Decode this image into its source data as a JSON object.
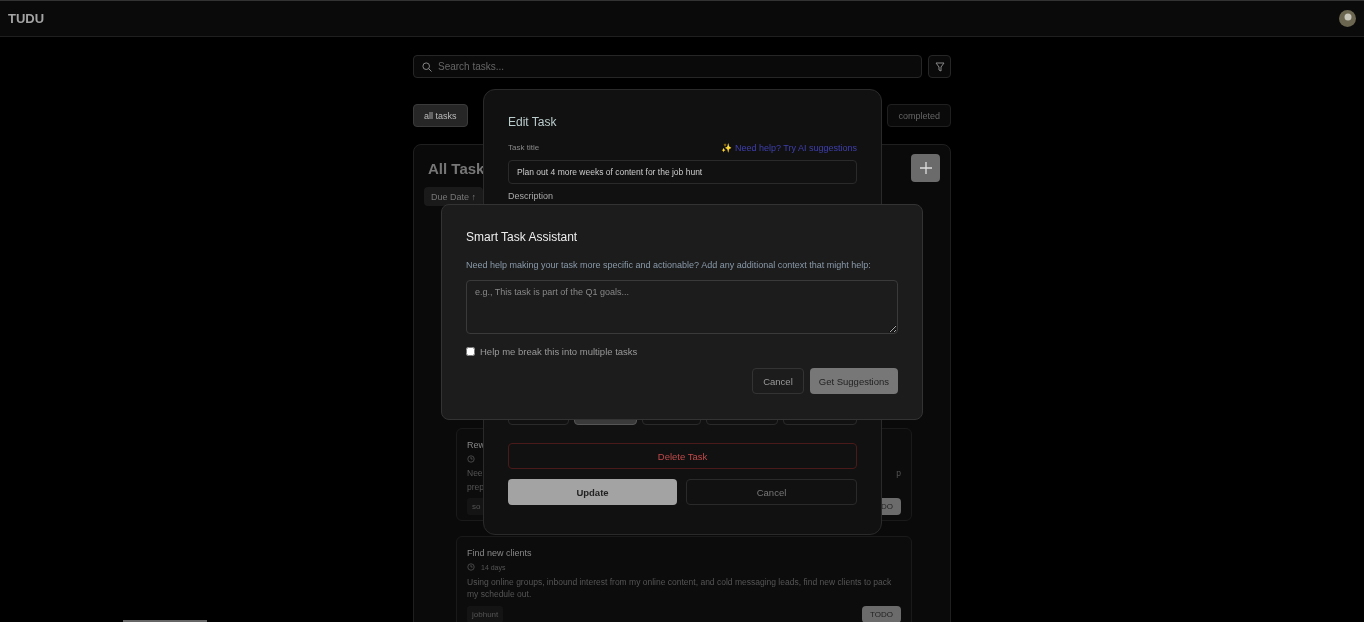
{
  "header": {
    "logo": "TUDU"
  },
  "search": {
    "placeholder": "Search tasks..."
  },
  "tabs": [
    {
      "label": "all tasks",
      "selected": true
    },
    {
      "label": "completed",
      "selected": false
    }
  ],
  "panel": {
    "title": "All Task",
    "sort": "Due Date ↑"
  },
  "cards": [
    {
      "title": "Rew",
      "lines": [
        "Nee",
        "prep"
      ],
      "tag": "so",
      "status": "DO",
      "right_text": "p"
    },
    {
      "title": "Find new clients",
      "due": "14 days",
      "lines": [
        "Using online groups, inbound interest from my online content, and cold messaging leads, find new clients to pack my schedule out."
      ],
      "tag": "jobhunt",
      "status": "TODO"
    }
  ],
  "edit_modal": {
    "title": "Edit Task",
    "title_label": "Task title",
    "ai_link": "✨ Need help? Try AI suggestions",
    "title_value": "Plan out 4 more weeks of content for the job hunt",
    "description_label": "Description",
    "status_options": [
      {
        "selected": false
      },
      {
        "selected": true
      },
      {
        "selected": false
      },
      {
        "selected": false
      },
      {
        "selected": false
      }
    ],
    "delete": "Delete Task",
    "update": "Update",
    "cancel": "Cancel"
  },
  "assistant": {
    "title": "Smart Task Assistant",
    "prompt": "Need help making your task more specific and actionable? Add any additional context that might help:",
    "placeholder": "e.g., This task is part of the Q1 goals...",
    "checkbox": {
      "label": "Help me break this into multiple tasks",
      "checked": false
    },
    "cancel": "Cancel",
    "submit": "Get Suggestions"
  }
}
